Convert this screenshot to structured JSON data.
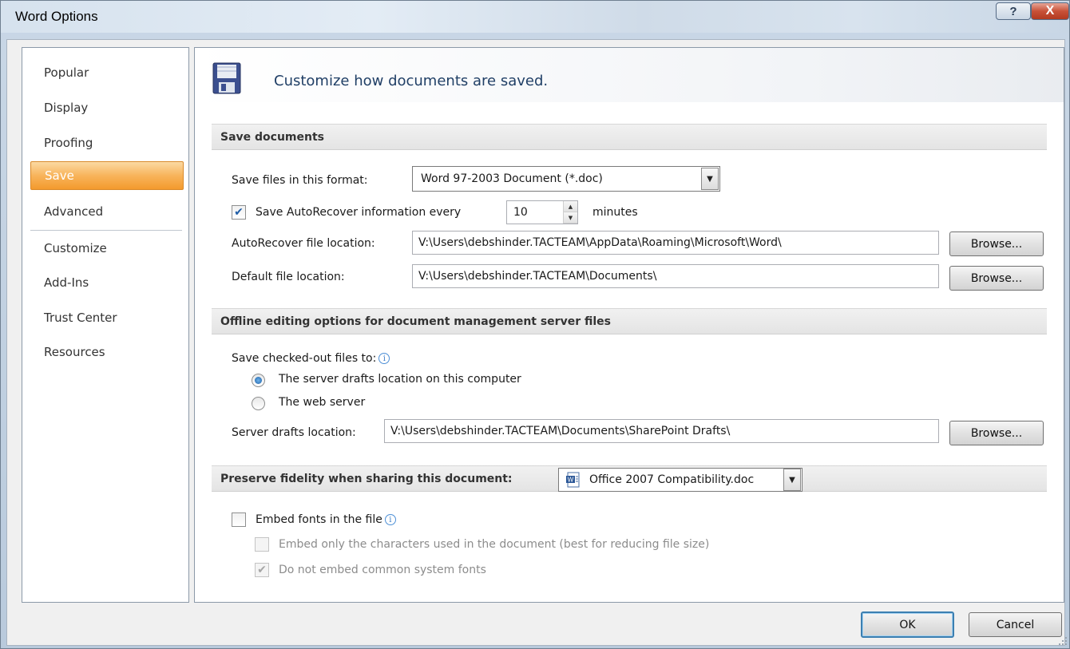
{
  "window": {
    "title": "Word Options",
    "help_glyph": "?",
    "close_glyph": "X"
  },
  "nav": {
    "items": [
      {
        "label": "Popular"
      },
      {
        "label": "Display"
      },
      {
        "label": "Proofing"
      },
      {
        "label": "Save",
        "selected": true
      },
      {
        "label": "Advanced"
      },
      {
        "label": "Customize"
      },
      {
        "label": "Add-Ins"
      },
      {
        "label": "Trust Center"
      },
      {
        "label": "Resources"
      }
    ]
  },
  "banner": {
    "heading": "Customize how documents are saved.",
    "icon": "floppy-disk-icon"
  },
  "save_documents": {
    "header": "Save documents",
    "format_label": "Save files in this format:",
    "format_value": "Word 97-2003 Document (*.doc)",
    "autorecover_label": "Save AutoRecover information every",
    "autorecover_checked": true,
    "autorecover_minutes": "10",
    "minutes_label": "minutes",
    "autorecover_location_label": "AutoRecover file location:",
    "autorecover_location_value": "V:\\Users\\debshinder.TACTEAM\\AppData\\Roaming\\Microsoft\\Word\\",
    "default_location_label": "Default file location:",
    "default_location_value": "V:\\Users\\debshinder.TACTEAM\\Documents\\",
    "browse_label": "Browse..."
  },
  "offline": {
    "header": "Offline editing options for document management server files",
    "save_checked_out_label": "Save checked-out files to:",
    "radio_server_drafts": "The server drafts location on this computer",
    "radio_web_server": "The web server",
    "selected": "server_drafts",
    "server_drafts_label": "Server drafts location:",
    "server_drafts_value": "V:\\Users\\debshinder.TACTEAM\\Documents\\SharePoint Drafts\\",
    "browse_label": "Browse..."
  },
  "fidelity": {
    "header": "Preserve fidelity when sharing this document:",
    "document_value": "Office 2007 Compatibility.doc",
    "embed_fonts_label": "Embed fonts in the file",
    "embed_fonts_checked": false,
    "embed_only_chars_label": "Embed only the characters used in the document (best for reducing file size)",
    "embed_only_chars_checked": false,
    "no_common_fonts_label": "Do not embed common system fonts",
    "no_common_fonts_checked": true
  },
  "footer": {
    "ok_label": "OK",
    "cancel_label": "Cancel"
  },
  "colors": {
    "accent_orange": "#f8b45b",
    "heading_blue": "#203f66",
    "check_blue": "#1f5da7"
  }
}
